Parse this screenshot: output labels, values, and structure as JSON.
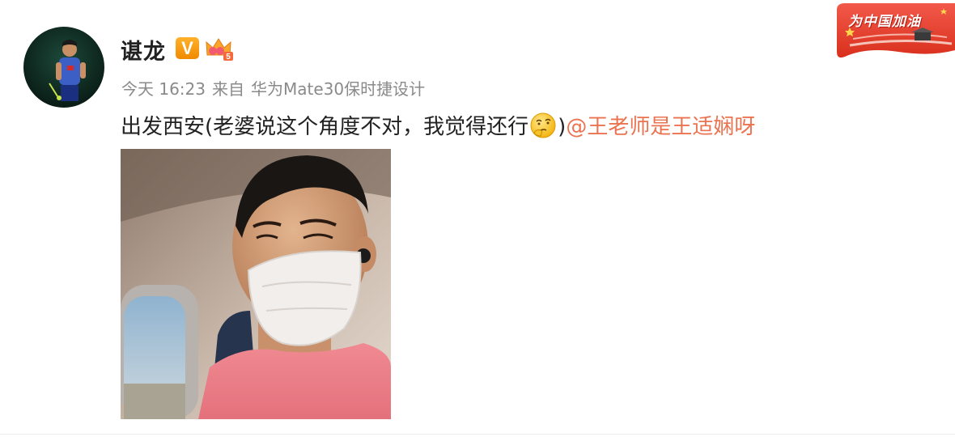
{
  "post": {
    "author": {
      "name": "谌龙",
      "verified_badge": "V",
      "member_level": "5",
      "avatar_icon": "avatar-badminton-player"
    },
    "meta": {
      "time": "今天 16:23",
      "source_prefix": "来自",
      "device": "华为Mate30保时捷设计"
    },
    "text": {
      "main": "出发西安(老婆说这个角度不对，我觉得还行",
      "emoji": "thinking-emoji",
      "close_paren": ")",
      "mention": "@王老师是王适娴呀"
    },
    "image": {
      "icon": "selfie-photo"
    }
  },
  "event_badge": {
    "label": "为中国加油"
  },
  "colors": {
    "mention": "#eb7350",
    "verified": "#f5a623",
    "badge_red": "#e8402a",
    "meta_gray": "#8a8a8a"
  }
}
